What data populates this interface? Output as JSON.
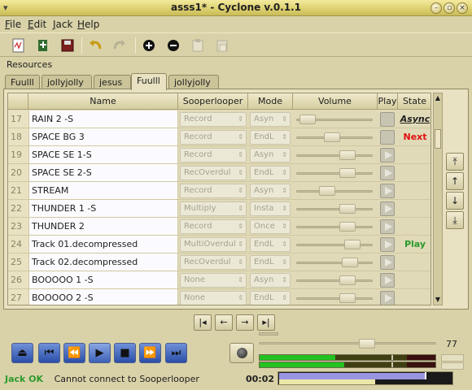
{
  "window": {
    "title": "asss1* - Cyclone v.0.1.1"
  },
  "menu": [
    {
      "mnemonic": "F",
      "rest": "ile"
    },
    {
      "mnemonic": "E",
      "rest": "dit"
    },
    {
      "mnemonic": "J",
      "rest": "ack"
    },
    {
      "mnemonic": "H",
      "rest": "elp"
    }
  ],
  "resources_label": "Resources",
  "tabs": [
    "Fuulll",
    "jollyjolly",
    "jesus",
    "Fuulll",
    "jollyjolly"
  ],
  "active_tab_index": 3,
  "columns": {
    "name": "Name",
    "sooperlooper": "Sooperlooper",
    "mode": "Mode",
    "volume": "Volume",
    "play": "Play",
    "state": "State"
  },
  "rows": [
    {
      "num": "17",
      "name": "RAIN 2    -S",
      "sl": "Record",
      "mode": "Asyn",
      "vol": 0.06,
      "play": "plain",
      "state": "Async",
      "state_color": "#202020",
      "state_style": "async"
    },
    {
      "num": "18",
      "name": "SPACE BG 3",
      "sl": "Record",
      "mode": "EndL",
      "vol": 0.48,
      "play": "plain",
      "state": "Next",
      "state_color": "#e01010",
      "state_style": "plain"
    },
    {
      "num": "19",
      "name": "SPACE SE 1-S",
      "sl": "Record",
      "mode": "Asyn",
      "vol": 0.75,
      "play": "tri",
      "state": "",
      "state_color": "#202020",
      "state_style": "plain"
    },
    {
      "num": "20",
      "name": "SPACE SE 2-S",
      "sl": "RecOverdul",
      "mode": "EndL",
      "vol": 0.75,
      "play": "tri",
      "state": "",
      "state_color": "#202020",
      "state_style": "plain"
    },
    {
      "num": "21",
      "name": "STREAM",
      "sl": "Record",
      "mode": "Asyn",
      "vol": 0.4,
      "play": "tri",
      "state": "",
      "state_color": "#202020",
      "state_style": "plain"
    },
    {
      "num": "22",
      "name": "THUNDER 1 -S",
      "sl": "Multiply",
      "mode": "Insta",
      "vol": 0.75,
      "play": "tri",
      "state": "",
      "state_color": "#202020",
      "state_style": "plain"
    },
    {
      "num": "23",
      "name": "THUNDER 2",
      "sl": "Record",
      "mode": "Once",
      "vol": 0.75,
      "play": "tri",
      "state": "",
      "state_color": "#202020",
      "state_style": "plain"
    },
    {
      "num": "24",
      "name": "Track 01.decompressed",
      "sl": "MultiOverdul",
      "mode": "EndL",
      "vol": 0.84,
      "play": "tri",
      "state": "Play",
      "state_color": "#2d9a2d",
      "state_style": "plain"
    },
    {
      "num": "25",
      "name": "Track 02.decompressed",
      "sl": "RecOverdul",
      "mode": "EndL",
      "vol": 0.8,
      "play": "tri",
      "state": "",
      "state_color": "#202020",
      "state_style": "plain"
    },
    {
      "num": "26",
      "name": "BOOOOO 1  -S",
      "sl": "None",
      "mode": "Asyn",
      "vol": 0.75,
      "play": "tri",
      "state": "",
      "state_color": "#202020",
      "state_style": "plain"
    },
    {
      "num": "27",
      "name": "BOOOOO 2  -S",
      "sl": "None",
      "mode": "EndL",
      "vol": 0.75,
      "play": "tri",
      "state": "",
      "state_color": "#202020",
      "state_style": "plain"
    },
    {
      "num": "",
      "name": "",
      "sl": "",
      "mode": "",
      "vol": null,
      "play": "",
      "state": "",
      "state_color": "#202020",
      "state_style": "plain"
    }
  ],
  "master_volume": {
    "value": "77",
    "level": 0.62
  },
  "meters": [
    {
      "green": 0.43,
      "peak": 0.75
    },
    {
      "green": 0.48,
      "peak": 0.75
    }
  ],
  "status": {
    "jack": "Jack OK",
    "jack_color": "#2d9a2d",
    "message": "Cannot connect to Sooperlooper",
    "time": "00:02"
  },
  "progress": {
    "top": 0.84,
    "bottom": 0.55
  }
}
